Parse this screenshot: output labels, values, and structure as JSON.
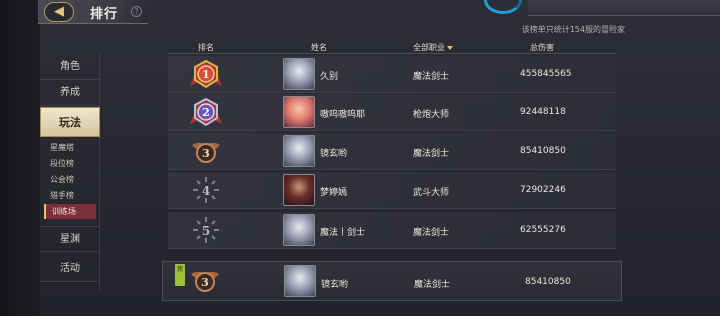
{
  "header": {
    "back_icon": "back-arrow-icon",
    "title": "排行",
    "help_icon": "question-icon"
  },
  "sidebar": {
    "items": [
      {
        "label": "角色"
      },
      {
        "label": "养成"
      },
      {
        "label": "玩法"
      }
    ],
    "sub_items": [
      {
        "label": "星魔塔"
      },
      {
        "label": "段位榜"
      },
      {
        "label": "公会榜"
      },
      {
        "label": "猎手榜"
      },
      {
        "label": "训练场"
      }
    ],
    "items_after": [
      {
        "label": "星渊"
      },
      {
        "label": "活动"
      }
    ],
    "active_item": "玩法",
    "active_sub_item": "训练场"
  },
  "board": {
    "info": "该榜单只统计154服的冒险家",
    "columns": {
      "rank": "排名",
      "name": "姓名",
      "job": "全部职业",
      "damage": "总伤害"
    },
    "rows": [
      {
        "rank": "1",
        "name": "久别",
        "job": "魔法剑士",
        "damage": "455845565",
        "avatar": "silver",
        "medal": "gold"
      },
      {
        "rank": "2",
        "name": "嗷呜嗷呜耶",
        "job": "枪炮大师",
        "damage": "92448118",
        "avatar": "pink",
        "medal": "silver"
      },
      {
        "rank": "3",
        "name": "镜玄哟",
        "job": "魔法剑士",
        "damage": "85410850",
        "avatar": "silver",
        "medal": "bronze"
      },
      {
        "rank": "4",
        "name": "梦婷嫣",
        "job": "武斗大师",
        "damage": "72902246",
        "avatar": "dark",
        "medal": "plain"
      },
      {
        "rank": "5",
        "name": "魔法丨剑士",
        "job": "魔法剑士",
        "damage": "62555276",
        "avatar": "silver",
        "medal": "plain"
      }
    ],
    "my_row": {
      "tag": "我",
      "rank": "3",
      "name": "镜玄哟",
      "job": "魔法剑士",
      "damage": "85410850",
      "avatar": "silver",
      "medal": "bronze"
    }
  },
  "colors": {
    "gold": "#e2b64a",
    "silver": "#b7c3d8",
    "bronze": "#c2865a",
    "ribbon_red": "#b0313c",
    "active_sub_bg": "#7a2f3a",
    "accent": "#e6c47a"
  }
}
